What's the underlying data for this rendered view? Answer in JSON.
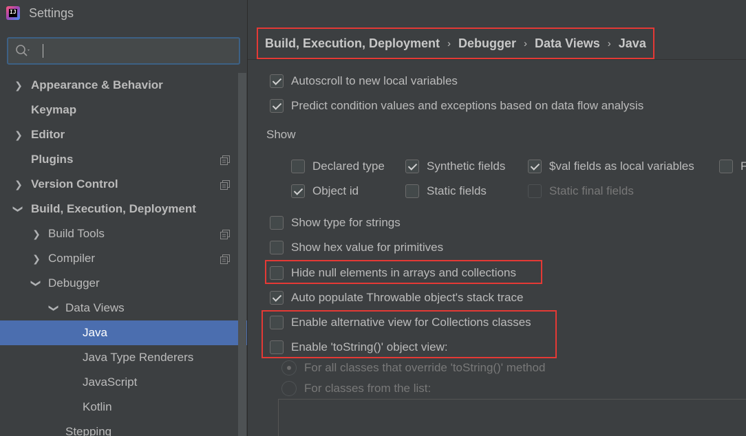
{
  "window": {
    "title": "Settings"
  },
  "search": {
    "placeholder": ""
  },
  "sidebar": {
    "items": [
      {
        "label": "Appearance & Behavior"
      },
      {
        "label": "Keymap"
      },
      {
        "label": "Editor"
      },
      {
        "label": "Plugins"
      },
      {
        "label": "Version Control"
      },
      {
        "label": "Build, Execution, Deployment"
      },
      {
        "label": "Build Tools"
      },
      {
        "label": "Compiler"
      },
      {
        "label": "Debugger"
      },
      {
        "label": "Data Views"
      },
      {
        "label": "Java"
      },
      {
        "label": "Java Type Renderers"
      },
      {
        "label": "JavaScript"
      },
      {
        "label": "Kotlin"
      },
      {
        "label": "Stepping"
      }
    ],
    "selected": "Java"
  },
  "breadcrumb": {
    "items": [
      "Build, Execution, Deployment",
      "Debugger",
      "Data Views",
      "Java"
    ],
    "separator": "›"
  },
  "options": {
    "autoscroll": {
      "label": "Autoscroll to new local variables",
      "checked": true
    },
    "predict": {
      "label": "Predict condition values and exceptions based on data flow analysis",
      "checked": true
    },
    "show_label": "Show",
    "show": {
      "declared_type": {
        "label": "Declared type",
        "checked": false
      },
      "synthetic_fields": {
        "label": "Synthetic fields",
        "checked": true
      },
      "val_fields": {
        "label": "$val fields as local variables",
        "checked": true
      },
      "fqn_partial": {
        "label": "F",
        "checked": false
      },
      "object_id": {
        "label": "Object id",
        "checked": true
      },
      "static_fields": {
        "label": "Static fields",
        "checked": false
      },
      "static_final_fields": {
        "label": "Static final fields",
        "checked": false,
        "disabled": true
      }
    },
    "type_for_strings": {
      "label": "Show type for strings",
      "checked": false
    },
    "hex_primitives": {
      "label": "Show hex value for primitives",
      "checked": false
    },
    "hide_null": {
      "label": "Hide null elements in arrays and collections",
      "checked": false
    },
    "auto_populate": {
      "label": "Auto populate Throwable object's stack trace",
      "checked": true
    },
    "alt_view": {
      "label": "Enable alternative view for Collections classes",
      "checked": false
    },
    "tostring_view": {
      "label": "Enable 'toString()' object view:",
      "checked": false
    },
    "radio_all": {
      "label": "For all classes that override 'toString()' method",
      "checked": true,
      "disabled": true
    },
    "radio_list": {
      "label": "For classes from the list:",
      "checked": false,
      "disabled": true
    }
  },
  "colors": {
    "background": "#3c3f41",
    "selection": "#4b6eaf",
    "highlight": "#e53935",
    "text": "#bbbbbb"
  }
}
